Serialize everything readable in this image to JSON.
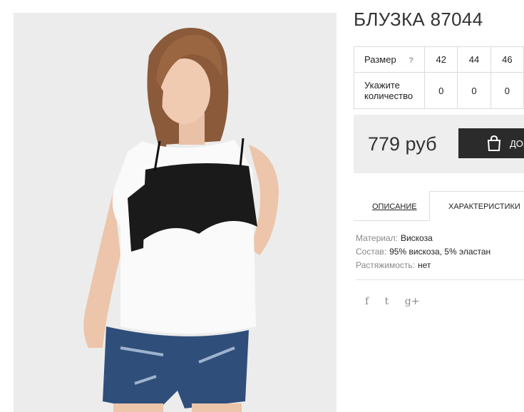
{
  "product": {
    "title": "БЛУЗКА 87044",
    "photo_icon": "product-photo"
  },
  "sizes": {
    "size_label": "Размер",
    "help": "?",
    "qty_label": "Укажите количество",
    "columns": [
      "42",
      "44",
      "46"
    ],
    "quantities": [
      "0",
      "0",
      "0"
    ]
  },
  "purchase": {
    "price": "779 руб",
    "button_label": "ДОБ",
    "button_icon": "shopping-bag-icon"
  },
  "tabs": {
    "description": "ОПИСАНИЕ",
    "characteristics": "ХАРАКТЕРИСТИКИ"
  },
  "characteristics": [
    {
      "label": "Материал:",
      "value": "Вискоза"
    },
    {
      "label": "Состав:",
      "value": "95% вискоза, 5% эластан"
    },
    {
      "label": "Растяжимость:",
      "value": "нет"
    }
  ],
  "social": [
    "f",
    "t",
    "g+"
  ],
  "colors": {
    "button": "#2b2b2b",
    "price_bg": "#eeeeee",
    "photo_bg": "#ececec"
  }
}
